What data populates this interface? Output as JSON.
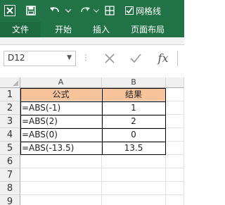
{
  "toolbar": {
    "gridlines_label": "网格线",
    "gridlines_checked": true,
    "accent": "#217346"
  },
  "tabs": [
    {
      "label": "文件"
    },
    {
      "label": "开始"
    },
    {
      "label": "插入"
    },
    {
      "label": "页面布局"
    }
  ],
  "formula_bar": {
    "name_box": "D12",
    "fx": "fx"
  },
  "sheet": {
    "columns": [
      "A",
      "B"
    ],
    "rows": [
      "1",
      "2",
      "3",
      "4",
      "5",
      "6",
      "7",
      "8",
      "9"
    ],
    "header_fill": "#f7c39a",
    "header": {
      "a": "公式",
      "b": "结果"
    },
    "data": [
      {
        "formula": "=ABS(-1)",
        "result": "1"
      },
      {
        "formula": "=ABS(2)",
        "result": "2"
      },
      {
        "formula": "=ABS(0)",
        "result": "0"
      },
      {
        "formula": "=ABS(-13.5)",
        "result": "13.5"
      }
    ]
  }
}
